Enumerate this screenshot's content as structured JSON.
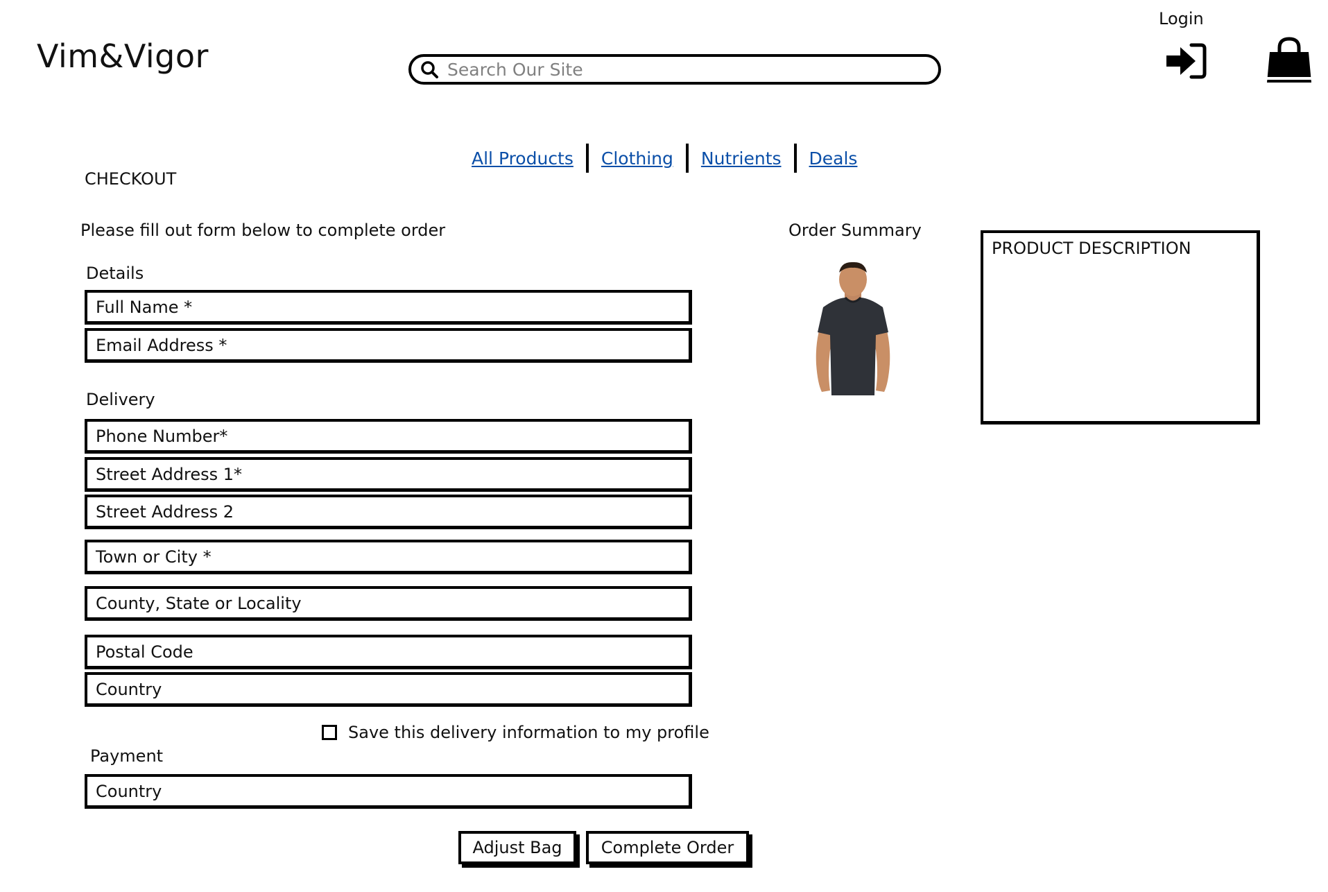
{
  "header": {
    "brand": "Vim&Vigor",
    "search_placeholder": "Search Our Site",
    "search_icon": "search-icon",
    "login_label": "Login",
    "login_icon": "sign-in-icon",
    "bag_icon": "shopping-bag-icon"
  },
  "nav": {
    "items": [
      {
        "label": "All Products"
      },
      {
        "label": "Clothing"
      },
      {
        "label": "Nutrients"
      },
      {
        "label": "Deals"
      }
    ],
    "link_color": "#0b4fa8"
  },
  "page": {
    "title": "CHECKOUT",
    "instructions": "Please fill out form below to complete order"
  },
  "form": {
    "details_label": "Details",
    "details_fields": [
      "Full Name *",
      "Email Address *"
    ],
    "delivery_label": "Delivery",
    "delivery_fields": [
      "Phone Number*",
      "Street Address 1*",
      "Street Address 2",
      "Town or City *",
      "County, State or Locality",
      "Postal Code",
      "Country"
    ],
    "save_info_label": "Save this delivery information to my profile",
    "save_info_checked": false,
    "payment_label": "Payment",
    "payment_fields": [
      "Country"
    ]
  },
  "buttons": {
    "adjust_bag": "Adjust Bag",
    "complete_order": "Complete Order"
  },
  "summary": {
    "title": "Order Summary",
    "product_image": "man-in-dark-tshirt-photo",
    "description_placeholder": "PRODUCT DESCRIPTION"
  }
}
